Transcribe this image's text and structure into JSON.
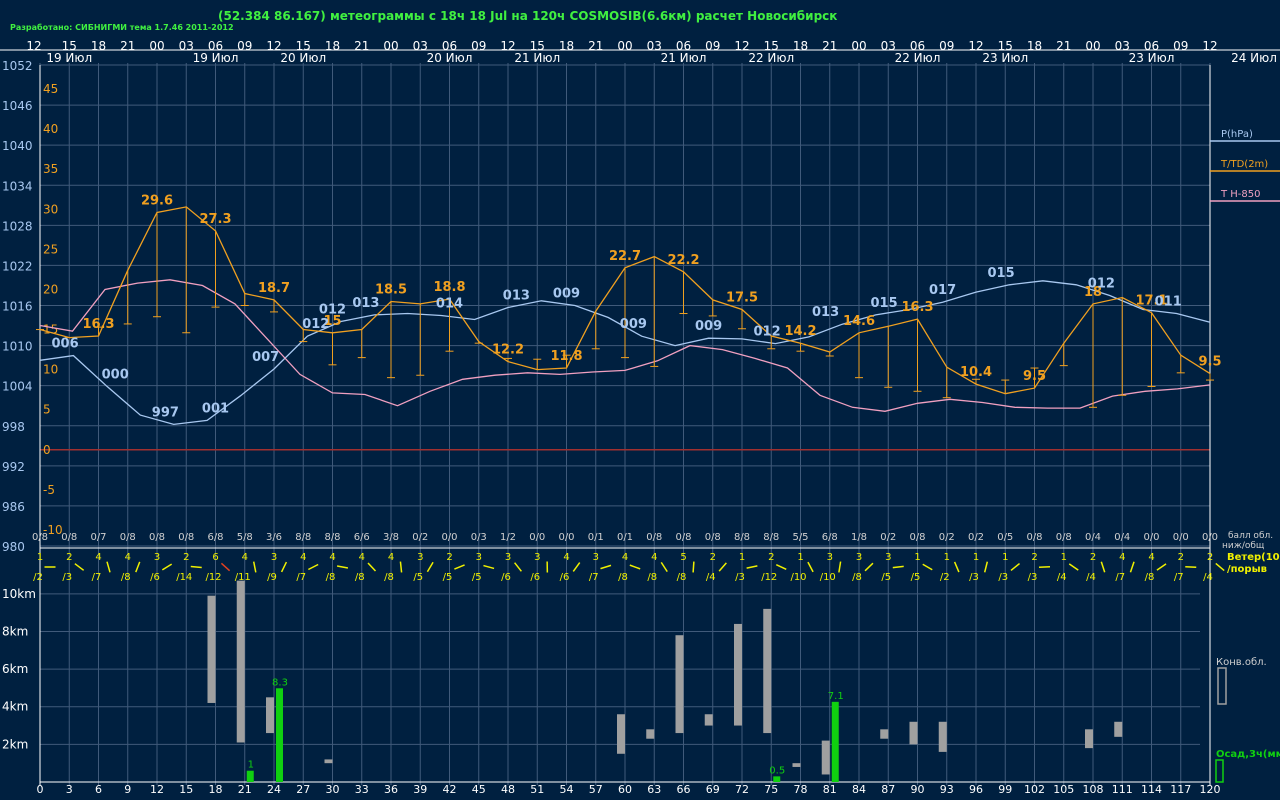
{
  "header": {
    "title": "(52.384 86.167) метеограммы с  18ч 18 Jul на 120ч COSMOSIB(6.6км) расчет Новосибирск",
    "credit": "Разработано: СИБНИГМИ тема 1.7.46 2011-2012"
  },
  "colors": {
    "background": "#002040",
    "grid": "#405a7a",
    "pressure": "#a8c8f0",
    "temperature": "#f0a020",
    "t850": "#f0a0c0",
    "zero_line": "#a03030",
    "cloud_text": "#d0d0d0",
    "wind": "#f0f000",
    "wind_alt": "#e04020",
    "precip": "#10d010",
    "conv_cloud": "#a0a0a0"
  },
  "chart_data": [
    {
      "type": "line",
      "name": "meteogram-main",
      "hour_ticks": [
        "12",
        "15",
        "18",
        "21",
        "00",
        "03",
        "06",
        "09",
        "12",
        "15",
        "18",
        "21",
        "00",
        "03",
        "06",
        "09",
        "12",
        "15",
        "18",
        "21",
        "00",
        "03",
        "06",
        "09",
        "12",
        "15",
        "18",
        "21",
        "00",
        "03",
        "06",
        "09",
        "12",
        "15",
        "18",
        "21",
        "00",
        "03",
        "06",
        "09",
        "12"
      ],
      "day_labels": [
        "19 Июл",
        "19 Июл",
        "20 Июл",
        "20 Июл",
        "21 Июл",
        "21 Июл",
        "22 Июл",
        "22 Июл",
        "23 Июл",
        "23 Июл",
        "24 Июл"
      ],
      "pressure_axis_ticks": [
        "1052",
        "1046",
        "1040",
        "1034",
        "1028",
        "1022",
        "1016",
        "1010",
        "1004",
        "998",
        "992",
        "986",
        "980"
      ],
      "temperature_axis_ticks": [
        "45",
        "40",
        "35",
        "30",
        "25",
        "20",
        "15",
        "10",
        "5",
        "0",
        "-5",
        "-10"
      ],
      "ylim_pressure": [
        980,
        1052
      ],
      "ylim_temperature": [
        -12,
        48
      ],
      "legend": [
        "P(hPa)",
        "T/TD(2m)",
        "T H-850"
      ],
      "x_hours": [
        0,
        3,
        6,
        9,
        12,
        15,
        18,
        21,
        24,
        27,
        30,
        33,
        36,
        39,
        42,
        45,
        48,
        51,
        54,
        57,
        60,
        63,
        66,
        69,
        72,
        75,
        78,
        81,
        84,
        87,
        90,
        93,
        96,
        99,
        102,
        105,
        108,
        111,
        114,
        117,
        120
      ],
      "series": [
        {
          "name": "P(hPa)",
          "values": [
            1007.8,
            1008.5,
            1003.9,
            999.6,
            998.2,
            998.8,
            1002.5,
            1006.5,
            1011.4,
            1013.6,
            1014.6,
            1014.8,
            1014.5,
            1013.9,
            1015.7,
            1016.7,
            1016.0,
            1014.2,
            1011.4,
            1010.0,
            1011.1,
            1011.0,
            1010.3,
            1011.3,
            1013.2,
            1014.6,
            1015.4,
            1016.5,
            1018.0,
            1019.1,
            1019.7,
            1019.1,
            1017.5,
            1015.4,
            1014.8,
            1013.5
          ],
          "label_values": [
            "006",
            "000",
            "997",
            "001",
            "007",
            "012",
            "012",
            "013",
            "014",
            "013",
            "009",
            "009",
            "009",
            "012",
            "013",
            "015",
            "017",
            "015",
            "012",
            "011"
          ]
        },
        {
          "name": "T/TD(2m)",
          "t": [
            15,
            14,
            14.2,
            22.4,
            29.6,
            30.3,
            27.3,
            19.5,
            18.7,
            15,
            14.6,
            15,
            18.5,
            18.2,
            18.8,
            13.5,
            11,
            10,
            10.2,
            17.3,
            22.7,
            24.1,
            22.2,
            18.7,
            17.5,
            14.2,
            13.3,
            12.2,
            14.6,
            15.4,
            16.3,
            10.3,
            8.2,
            7,
            7.7,
            13.3,
            18.2,
            19,
            17.1,
            11.8,
            9.5
          ],
          "td": [
            15,
            14,
            15.3,
            15.7,
            16.6,
            14.6,
            17.8,
            18,
            17.2,
            13.5,
            10.6,
            11.5,
            9,
            9.3,
            12.3,
            13.3,
            11.4,
            11.3,
            11.8,
            12.6,
            11.5,
            10.4,
            17,
            16.7,
            15.1,
            12.6,
            12.3,
            11.7,
            9,
            7.8,
            7.3,
            6.5,
            8.8,
            8.7,
            10.2,
            10.5,
            5.3,
            6.8,
            7.9,
            9.6,
            8.7
          ],
          "label_values": [
            "16.3",
            "29.6",
            "27.3",
            "18.7",
            "15",
            "18.5",
            "18.8",
            "12.2",
            "11.8",
            "22.7",
            "22.2",
            "17.5",
            "14.2",
            "14.6",
            "16.3",
            "10.4",
            "9.5",
            "18",
            "17.1",
            "9.5"
          ]
        },
        {
          "name": "T H-850",
          "values": [
            15.5,
            14.8,
            20,
            20.8,
            21.2,
            20.5,
            18.2,
            13.8,
            9.4,
            7.1,
            6.9,
            5.5,
            7.3,
            8.8,
            9.3,
            9.6,
            9.4,
            9.7,
            9.9,
            11.1,
            13,
            12.5,
            11.4,
            10.2,
            6.8,
            5.3,
            4.8,
            5.8,
            6.3,
            5.9,
            5.3,
            5.2,
            5.2,
            6.7,
            7.3,
            7.6,
            8.1
          ]
        }
      ]
    },
    {
      "type": "table",
      "name": "cloud-cover",
      "legend": "балл обл. ниж/общ",
      "values": [
        "0/8",
        "0/8",
        "0/7",
        "0/8",
        "0/8",
        "0/8",
        "6/8",
        "5/8",
        "3/6",
        "8/8",
        "8/8",
        "6/6",
        "3/8",
        "0/2",
        "0/0",
        "0/3",
        "1/2",
        "0/0",
        "0/0",
        "0/1",
        "0/1",
        "0/8",
        "0/8",
        "0/8",
        "8/8",
        "8/8",
        "5/5",
        "6/8",
        "1/8",
        "0/2",
        "0/8",
        "0/2",
        "0/2",
        "0/5",
        "0/8",
        "0/8",
        "0/4",
        "0/4",
        "0/0",
        "0/0",
        "0/0"
      ]
    },
    {
      "type": "table",
      "name": "wind",
      "legend": [
        "Ветер(10м)",
        "/порыв"
      ],
      "speeds": [
        "1",
        "2",
        "4",
        "4",
        "3",
        "2",
        "6",
        "4",
        "3",
        "4",
        "4",
        "4",
        "4",
        "3",
        "2",
        "3",
        "3",
        "3",
        "4",
        "3",
        "4",
        "4",
        "5",
        "2",
        "1",
        "2",
        "1",
        "3",
        "3",
        "3",
        "1",
        "1",
        "1",
        "1",
        "2",
        "1",
        "2",
        "4",
        "4",
        "2",
        "2"
      ],
      "gusts": [
        "/2",
        "/3",
        "/7",
        "/8",
        "/6",
        "/14",
        "/12",
        "/11",
        "/9",
        "/7",
        "/8",
        "/8",
        "/8",
        "/5",
        "/5",
        "/5",
        "/6",
        "/6",
        "/6",
        "/7",
        "/8",
        "/8",
        "/8",
        "/4",
        "/3",
        "/12",
        "/10",
        "/10",
        "/8",
        "/5",
        "/5",
        "/2",
        "/3",
        "/3",
        "/3",
        "/4",
        "/4",
        "/7",
        "/8",
        "/7",
        "/4"
      ]
    },
    {
      "type": "bar",
      "name": "convective-clouds-and-precip",
      "x_ticks": [
        "0",
        "3",
        "6",
        "9",
        "12",
        "15",
        "18",
        "21",
        "24",
        "27",
        "30",
        "33",
        "36",
        "39",
        "42",
        "45",
        "48",
        "51",
        "54",
        "57",
        "60",
        "63",
        "66",
        "69",
        "72",
        "75",
        "78",
        "81",
        "84",
        "87",
        "90",
        "93",
        "96",
        "99",
        "102",
        "105",
        "108",
        "111",
        "114",
        "117",
        "120"
      ],
      "y_ticks": [
        "10km",
        "8km",
        "6km",
        "4km",
        "2km"
      ],
      "ylim_km": [
        0,
        11
      ],
      "legend": [
        "Конв.обл.",
        "Осад,3ч(мм)"
      ],
      "conv_clouds": [
        {
          "x": 18,
          "base": 4.2,
          "top": 9.9
        },
        {
          "x": 21,
          "base": 2.1,
          "top": 10.7
        },
        {
          "x": 24,
          "base": 2.6,
          "top": 4.5
        },
        {
          "x": 30,
          "base": 1.0,
          "top": 1.2
        },
        {
          "x": 60,
          "base": 1.5,
          "top": 3.6
        },
        {
          "x": 63,
          "base": 2.3,
          "top": 2.8
        },
        {
          "x": 66,
          "base": 2.6,
          "top": 7.8
        },
        {
          "x": 69,
          "base": 3.0,
          "top": 3.6
        },
        {
          "x": 72,
          "base": 3.0,
          "top": 8.4
        },
        {
          "x": 75,
          "base": 2.6,
          "top": 9.2
        },
        {
          "x": 78,
          "base": 0.8,
          "top": 1.0
        },
        {
          "x": 81,
          "base": 0.4,
          "top": 2.2
        },
        {
          "x": 87,
          "base": 2.3,
          "top": 2.8
        },
        {
          "x": 90,
          "base": 2.0,
          "top": 3.2
        },
        {
          "x": 93,
          "base": 1.6,
          "top": 3.2
        },
        {
          "x": 108,
          "base": 1.8,
          "top": 2.8
        },
        {
          "x": 111,
          "base": 2.4,
          "top": 3.2
        }
      ],
      "precip": [
        {
          "x": 21,
          "value": 1,
          "label": "1"
        },
        {
          "x": 24,
          "value": 8.3,
          "label": "8.3"
        },
        {
          "x": 75,
          "value": 0.5,
          "label": "0.5"
        },
        {
          "x": 81,
          "value": 7.1,
          "label": "7.1"
        }
      ]
    }
  ]
}
